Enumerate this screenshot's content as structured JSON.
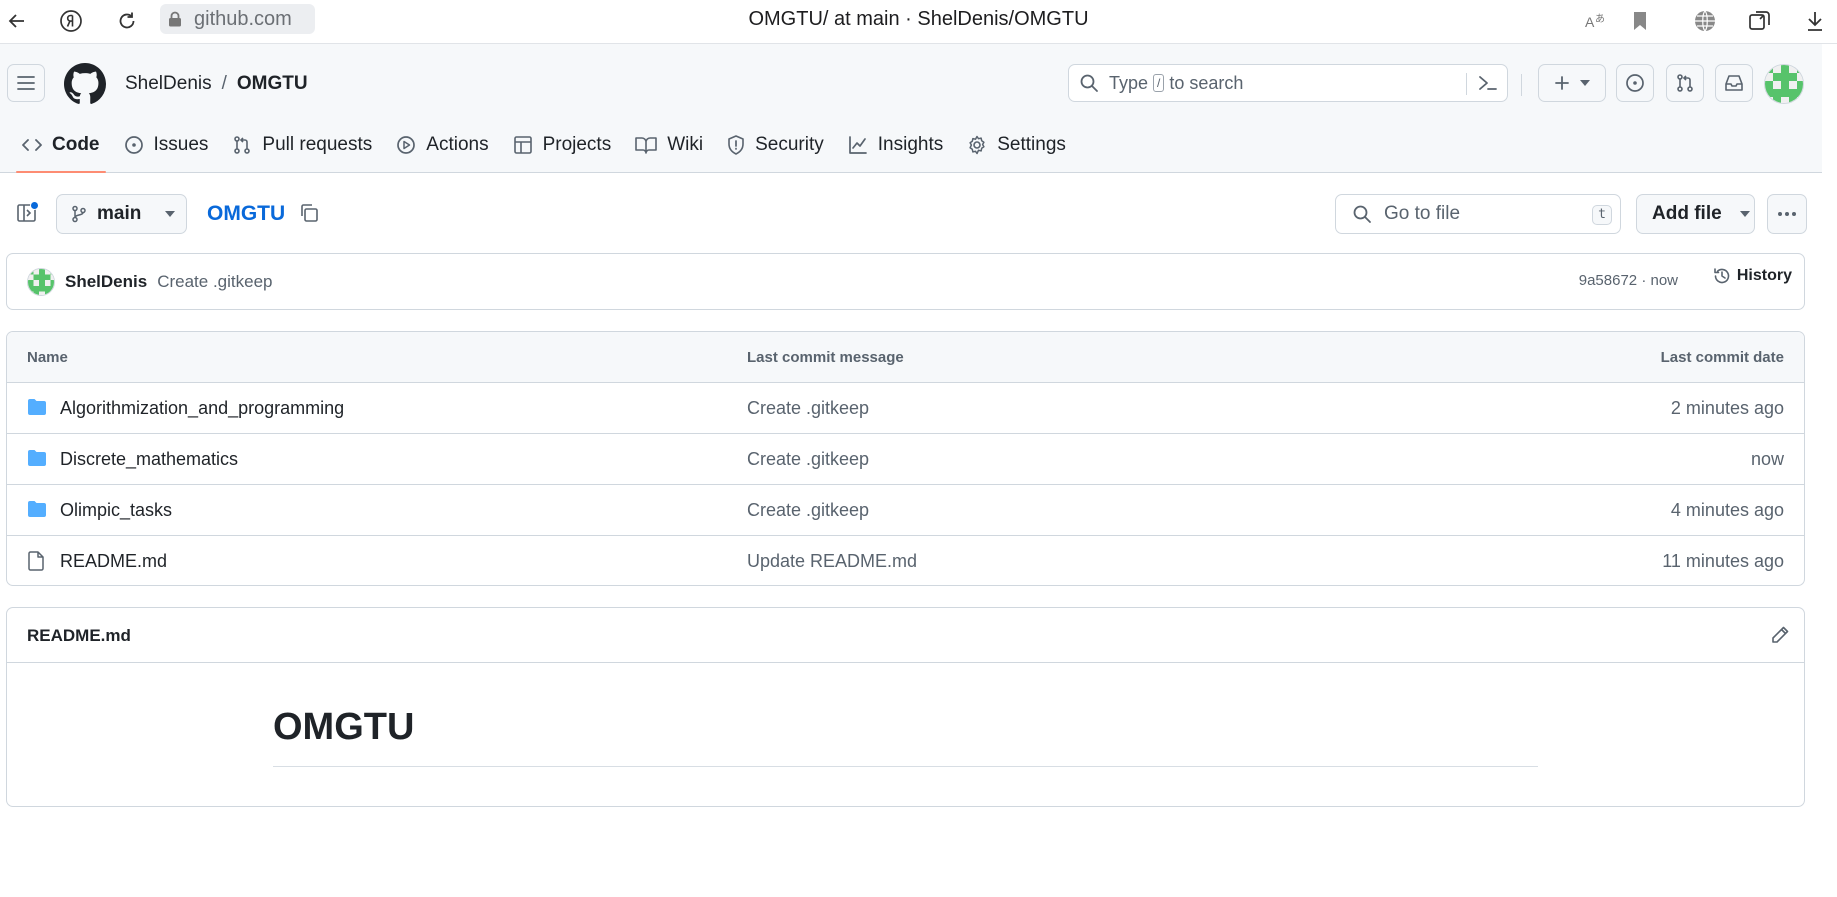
{
  "browser": {
    "domain": "github.com",
    "window_title": "OMGTU/ at main · ShelDenis/OMGTU"
  },
  "header": {
    "owner": "ShelDenis",
    "separator": "/",
    "repo": "OMGTU",
    "search_prefix": "Type",
    "search_key": "/",
    "search_suffix": "to search"
  },
  "repo_nav": {
    "tabs": [
      {
        "label": "Code",
        "icon": "code-icon",
        "active": true
      },
      {
        "label": "Issues",
        "icon": "issue-icon"
      },
      {
        "label": "Pull requests",
        "icon": "pull-request-icon"
      },
      {
        "label": "Actions",
        "icon": "play-icon"
      },
      {
        "label": "Projects",
        "icon": "table-icon"
      },
      {
        "label": "Wiki",
        "icon": "book-icon"
      },
      {
        "label": "Security",
        "icon": "shield-icon"
      },
      {
        "label": "Insights",
        "icon": "graph-icon"
      },
      {
        "label": "Settings",
        "icon": "gear-icon"
      }
    ]
  },
  "toolbar": {
    "branch": "main",
    "repo_link": "OMGTU",
    "goto_placeholder": "Go to file",
    "goto_hotkey": "t",
    "add_file": "Add file"
  },
  "latest_commit": {
    "author": "ShelDenis",
    "message": "Create .gitkeep",
    "meta": "9a58672 · now",
    "history_label": "History"
  },
  "file_table": {
    "headers": {
      "name": "Name",
      "message": "Last commit message",
      "date": "Last commit date"
    },
    "rows": [
      {
        "type": "folder",
        "name": "Algorithmization_and_programming",
        "message": "Create .gitkeep",
        "date": "2 minutes ago"
      },
      {
        "type": "folder",
        "name": "Discrete_mathematics",
        "message": "Create .gitkeep",
        "date": "now"
      },
      {
        "type": "folder",
        "name": "Olimpic_tasks",
        "message": "Create .gitkeep",
        "date": "4 minutes ago"
      },
      {
        "type": "file",
        "name": "README.md",
        "message": "Update README.md",
        "date": "11 minutes ago"
      }
    ]
  },
  "readme": {
    "title": "README.md",
    "heading": "OMGTU"
  },
  "colors": {
    "accent_link": "#0969da",
    "folder": "#54aeff",
    "active_tab_underline": "#fd8c73",
    "avatar_green": "#57c36b"
  }
}
